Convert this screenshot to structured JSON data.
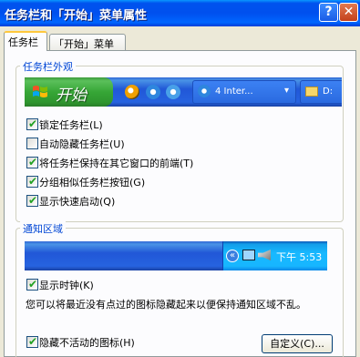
{
  "window": {
    "title": "任务栏和「开始」菜单属性",
    "help_glyph": "?",
    "close_glyph": "✕"
  },
  "tabs": [
    {
      "label": "任务栏",
      "active": true
    },
    {
      "label": "「开始」菜单",
      "active": false
    }
  ],
  "appearance_group": {
    "label": "任务栏外观",
    "preview": {
      "start_label": "开始",
      "quicklaunch_icons": [
        "media-player-icon",
        "internet-explorer-icon",
        "outlook-express-icon"
      ],
      "task_buttons": [
        {
          "label": "4 Inter...",
          "icon": "internet-explorer-icon",
          "arrow": "▾"
        },
        {
          "label": "D:",
          "icon": "folder-icon"
        }
      ]
    },
    "options": [
      {
        "label": "锁定任务栏(L)",
        "checked": true
      },
      {
        "label": "自动隐藏任务栏(U)",
        "checked": false
      },
      {
        "label": "将任务栏保持在其它窗口的前端(T)",
        "checked": true
      },
      {
        "label": "分组相似任务栏按钮(G)",
        "checked": true
      },
      {
        "label": "显示快速启动(Q)",
        "checked": true
      }
    ]
  },
  "notify_group": {
    "label": "通知区域",
    "preview": {
      "expand_glyph": "«",
      "clock": "下午 5:53",
      "tray_icons": [
        "network-icon",
        "speaker-icon"
      ]
    },
    "show_clock": {
      "label": "显示时钟(K)",
      "checked": true
    },
    "note": "您可以将最近没有点过的图标隐藏起来以便保持通知区域不乱。",
    "hide_inactive": {
      "label": "隐藏不活动的图标(H)",
      "checked": true
    },
    "customize_label": "自定义(C)..."
  },
  "colors": {
    "title_blue": "#0053ee",
    "start_green": "#36a636",
    "taskbar_blue": "#2157d7",
    "tray_blue": "#18b9ff",
    "group_label": "#0046d5",
    "check_green": "#21a121"
  }
}
